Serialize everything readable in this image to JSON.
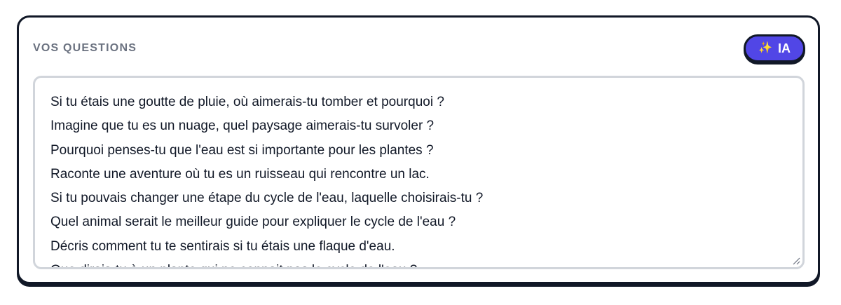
{
  "section": {
    "title": "VOS QUESTIONS"
  },
  "ia_button": {
    "label": "IA",
    "icon": "sparkles-icon"
  },
  "questions": {
    "lines": [
      "Si tu étais une goutte de pluie, où aimerais-tu tomber et pourquoi ?",
      "Imagine que tu es un nuage, quel paysage aimerais-tu survoler ?",
      "Pourquoi penses-tu que l'eau est si importante pour les plantes ?",
      "Raconte une aventure où tu es un ruisseau qui rencontre un lac.",
      "Si tu pouvais changer une étape du cycle de l'eau, laquelle choisirais-tu ?",
      "Quel animal serait le meilleur guide pour expliquer le cycle de l'eau ?",
      "Décris comment tu te sentirais si tu étais une flaque d'eau.",
      "Que dirais-tu à un plante qui ne connait pas le cycle de l'eau ?"
    ]
  },
  "colors": {
    "accent": "#5146e6",
    "border": "#111827",
    "label": "#6b7280",
    "textarea_border": "#d1d5db"
  }
}
